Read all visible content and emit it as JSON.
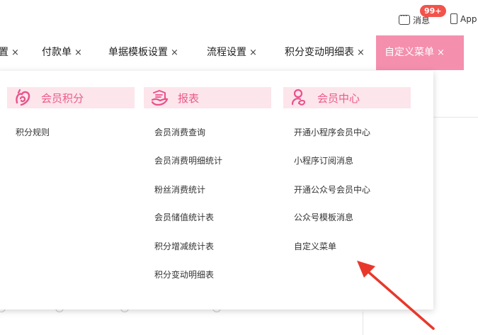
{
  "topbar": {
    "message_label": "消息",
    "badge": "99+",
    "app_label": "App"
  },
  "tabs": [
    {
      "label": "置",
      "active": false
    },
    {
      "label": "付款单",
      "active": false
    },
    {
      "label": "单据模板设置",
      "active": false
    },
    {
      "label": "流程设置",
      "active": false
    },
    {
      "label": "积分变动明细表",
      "active": false
    },
    {
      "label": "自定义菜单",
      "active": true
    }
  ],
  "close_glyph": "×",
  "menu": {
    "columns": [
      {
        "title": "会员积分",
        "icon": "heart-swirl-icon",
        "items": [
          "积分规则"
        ]
      },
      {
        "title": "报表",
        "icon": "report-hand-icon",
        "items": [
          "会员消费查询",
          "会员消费明细统计",
          "粉丝消费统计",
          "会员储值统计表",
          "积分增减统计表",
          "积分变动明细表"
        ]
      },
      {
        "title": "会员中心",
        "icon": "member-person-icon",
        "items": [
          "开通小程序会员中心",
          "小程序订阅消息",
          "开通公众号会员中心",
          "公众号模板消息",
          "自定义菜单"
        ]
      }
    ]
  },
  "colors": {
    "accent": "#f58fae",
    "header_bg": "#fde5ec",
    "header_text": "#ea5b89",
    "badge": "#f2534b",
    "annotation_arrow": "#e8382b"
  }
}
